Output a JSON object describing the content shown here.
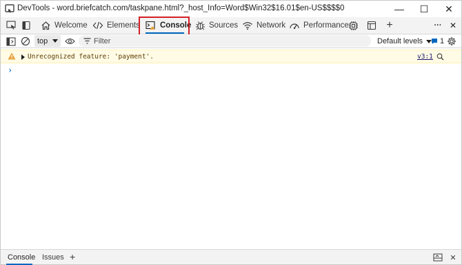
{
  "window": {
    "title": "DevTools - word.briefcatch.com/taskpane.html?_host_Info=Word$Win32$16.01$en-US$$$$0",
    "minimize_glyph": "—",
    "maximize_glyph": "☐",
    "close_glyph": "✕"
  },
  "tabs": [
    {
      "label": "Welcome",
      "icon": "home-icon"
    },
    {
      "label": "Elements",
      "icon": "code-brackets-icon"
    },
    {
      "label": "Console",
      "icon": "console-icon",
      "active": true
    },
    {
      "label": "Sources",
      "icon": "bug-icon"
    },
    {
      "label": "Network",
      "icon": "wifi-icon"
    },
    {
      "label": "Performance",
      "icon": "performance-icon"
    }
  ],
  "tabbar": {
    "add_glyph": "+",
    "more_glyph": "···",
    "close_glyph": "✕"
  },
  "console_toolbar": {
    "context": "top",
    "filter_placeholder": "Filter",
    "levels": "Default levels",
    "issues_count": "1"
  },
  "messages": [
    {
      "level": "warning",
      "text": "Unrecognized feature: 'payment'.",
      "source": "v3:1"
    }
  ],
  "prompt_glyph": "›",
  "drawer": {
    "tabs": [
      {
        "label": "Console",
        "active": true
      },
      {
        "label": "Issues"
      }
    ],
    "add_glyph": "+"
  },
  "colors": {
    "accent": "#0067c0",
    "highlight_box": "#d21f24",
    "warning_bg": "#fffbe5",
    "warning_icon": "#e8a33d"
  }
}
